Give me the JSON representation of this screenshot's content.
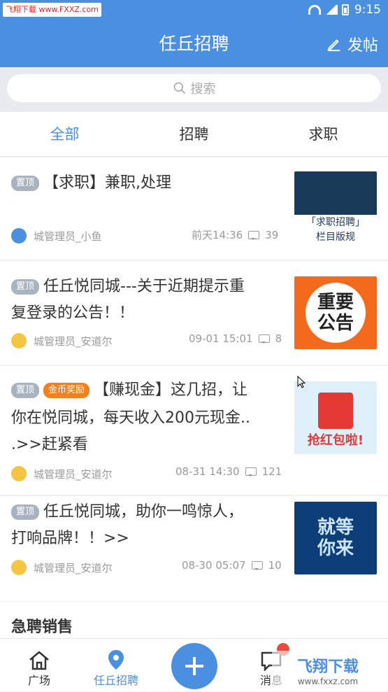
{
  "status": {
    "watermark": "飞翔下载 www.FXXZ.com",
    "time": "9:15"
  },
  "header": {
    "title": "任丘招聘",
    "post_label": "发帖",
    "post_icon": "pencil-icon"
  },
  "search": {
    "placeholder": "搜索",
    "icon": "search-icon"
  },
  "tabs": [
    {
      "label": "全部",
      "active": true
    },
    {
      "label": "招聘",
      "active": false
    },
    {
      "label": "求职",
      "active": false
    }
  ],
  "posts": [
    {
      "tag": "置顶",
      "tag2": "",
      "title_line1": "【求职】兼职,处理",
      "title_line2": "",
      "title_line3": "",
      "author": "城管理员_小鱼",
      "time": "前天14:36",
      "comments": "39",
      "thumb_text1": "「求职招聘」",
      "thumb_text2": "栏目版规"
    },
    {
      "tag": "置顶",
      "tag2": "",
      "title_line1": "任丘悦同城---关于近期提示重",
      "title_line2": "复登录的公告！！",
      "title_line3": "",
      "author": "城管理员_安道尔",
      "time": "09-01 15:01",
      "comments": "8",
      "thumb_text1": "重要",
      "thumb_text2": "公告"
    },
    {
      "tag": "置顶",
      "tag2": "金币奖励",
      "title_line1": "【赚现金】这几招，让",
      "title_line2": "你在悦同城，每天收入200元现金..",
      "title_line3": ".>>赶紧看",
      "author": "城管理员_安道尔",
      "time": "08-31 14:30",
      "comments": "121",
      "thumb_text1": "抢红包啦!",
      "thumb_text2": ""
    },
    {
      "tag": "置顶",
      "tag2": "",
      "title_line1": "任丘悦同城，助你一鸣惊人，",
      "title_line2": "打响品牌！！>>",
      "title_line3": "",
      "author": "城管理员_安道尔",
      "time": "08-30 05:07",
      "comments": "10",
      "thumb_text1": "就等",
      "thumb_text2": "你来"
    }
  ],
  "section": {
    "title": "急聘销售"
  },
  "bottom_nav": [
    {
      "label": "广场",
      "icon": "home-icon"
    },
    {
      "label": "任丘招聘",
      "icon": "location-icon"
    },
    {
      "label": "",
      "icon": "plus-icon"
    },
    {
      "label": "消息",
      "icon": "message-icon"
    }
  ],
  "watermark_bottom": {
    "line1": "飞翔下载",
    "line2": "www.fxxz.com"
  },
  "colors": {
    "accent": "#4a8fe0",
    "tag": "#a9b3c0",
    "tag_orange": "#f08020"
  }
}
